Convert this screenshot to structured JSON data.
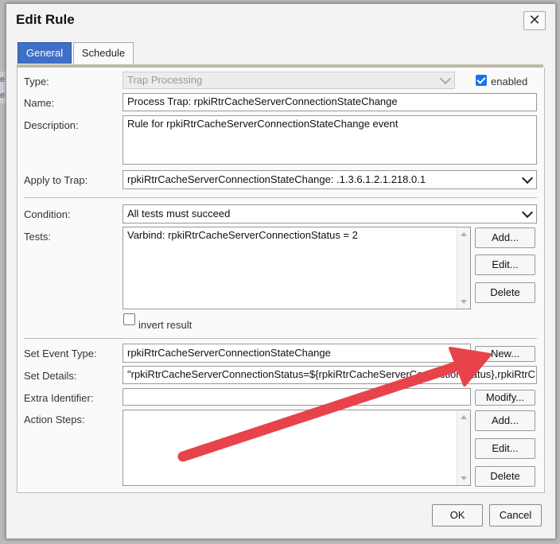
{
  "background": {
    "left_glyphs": "e\ne"
  },
  "dialog": {
    "title": "Edit Rule",
    "close_glyph": "✕"
  },
  "tabs": [
    {
      "label": "General"
    },
    {
      "label": "Schedule"
    }
  ],
  "form": {
    "type": {
      "label": "Type:",
      "value": "Trap Processing",
      "enabled_label": "enabled"
    },
    "name": {
      "label": "Name:",
      "value": "Process Trap: rpkiRtrCacheServerConnectionStateChange"
    },
    "description": {
      "label": "Description:",
      "value": "Rule for rpkiRtrCacheServerConnectionStateChange event"
    },
    "apply_to_trap": {
      "label": "Apply to Trap:",
      "value": "rpkiRtrCacheServerConnectionStateChange: .1.3.6.1.2.1.218.0.1"
    },
    "condition": {
      "label": "Condition:",
      "value": "All tests must succeed"
    },
    "tests": {
      "label": "Tests:",
      "items": [
        "Varbind: rpkiRtrCacheServerConnectionStatus = 2"
      ],
      "invert_label": "invert result",
      "add": "Add...",
      "edit": "Edit...",
      "delete": "Delete"
    },
    "set_event_type": {
      "label": "Set Event Type:",
      "value": "rpkiRtrCacheServerConnectionStateChange",
      "new_button": "New..."
    },
    "set_details": {
      "label": "Set Details:",
      "value": "\"rpkiRtrCacheServerConnectionStatus=${rpkiRtrCacheServerConnectionStatus},rpkiRtrC"
    },
    "extra_identifier": {
      "label": "Extra Identifier:",
      "value": "",
      "modify_button": "Modify..."
    },
    "action_steps": {
      "label": "Action Steps:",
      "add": "Add...",
      "edit": "Edit...",
      "delete": "Delete"
    }
  },
  "footer": {
    "ok": "OK",
    "cancel": "Cancel"
  },
  "colors": {
    "accent": "#3f6fc6",
    "annotation_arrow": "#e8434a",
    "checkbox": "#1a73e8"
  }
}
